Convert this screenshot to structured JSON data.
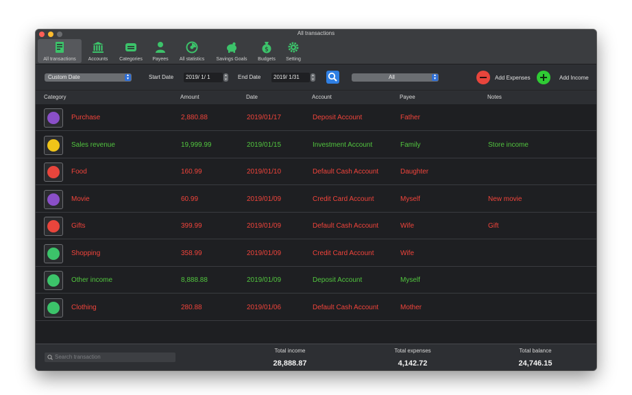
{
  "window": {
    "title": "All transactions"
  },
  "toolbar": {
    "items": [
      {
        "label": "All transactions",
        "icon": "transactions-icon"
      },
      {
        "label": "Accounts",
        "icon": "bank-icon"
      },
      {
        "label": "Categories",
        "icon": "categories-icon"
      },
      {
        "label": "Payees",
        "icon": "person-icon"
      },
      {
        "label": "All statistics",
        "icon": "statistics-icon"
      },
      {
        "label": "Savings Goals",
        "icon": "piggy-bank-icon"
      },
      {
        "label": "Budgets",
        "icon": "money-bag-icon"
      },
      {
        "label": "Setting",
        "icon": "gear-icon"
      }
    ],
    "accent": "#3cc36a"
  },
  "filter": {
    "date_mode": "Custom Date",
    "start_label": "Start Date",
    "start_value": "2019/  1/  1",
    "end_label": "End Date",
    "end_value": "2019/  1/31",
    "account_select": "All",
    "add_expenses": "Add Expenses",
    "add_income": "Add Income"
  },
  "columns": {
    "category": "Category",
    "amount": "Amount",
    "date": "Date",
    "account": "Account",
    "payee": "Payee",
    "notes": "Notes"
  },
  "rows": [
    {
      "category": "Purchase",
      "amount": "2,880.88",
      "date": "2019/01/17",
      "account": "Deposit Account",
      "payee": "Father",
      "notes": "",
      "type": "expense",
      "icon_color": "#8a4fc8"
    },
    {
      "category": "Sales revenue",
      "amount": "19,999.99",
      "date": "2019/01/15",
      "account": "Investment Account",
      "payee": "Family",
      "notes": "Store income",
      "type": "income",
      "icon_color": "#f0c419"
    },
    {
      "category": "Food",
      "amount": "160.99",
      "date": "2019/01/10",
      "account": "Default Cash Account",
      "payee": "Daughter",
      "notes": "",
      "type": "expense",
      "icon_color": "#e8453c"
    },
    {
      "category": "Movie",
      "amount": "60.99",
      "date": "2019/01/09",
      "account": "Credit Card Account",
      "payee": "Myself",
      "notes": "New movie",
      "type": "expense",
      "icon_color": "#8a4fc8"
    },
    {
      "category": "Gifts",
      "amount": "399.99",
      "date": "2019/01/09",
      "account": "Default Cash Account",
      "payee": "Wife",
      "notes": "Gift",
      "type": "expense",
      "icon_color": "#e8453c"
    },
    {
      "category": "Shopping",
      "amount": "358.99",
      "date": "2019/01/09",
      "account": "Credit Card Account",
      "payee": "Wife",
      "notes": "",
      "type": "expense",
      "icon_color": "#3cc36a"
    },
    {
      "category": "Other income",
      "amount": "8,888.88",
      "date": "2019/01/09",
      "account": "Deposit Account",
      "payee": "Myself",
      "notes": "",
      "type": "income",
      "icon_color": "#3cc36a"
    },
    {
      "category": "Clothing",
      "amount": "280.88",
      "date": "2019/01/06",
      "account": "Default Cash Account",
      "payee": "Mother",
      "notes": "",
      "type": "expense",
      "icon_color": "#3cc36a"
    }
  ],
  "colors": {
    "expense": "#f2443b",
    "income": "#52c63f"
  },
  "footer": {
    "search_placeholder": "Search transaction",
    "total_income_label": "Total income",
    "total_income": "28,888.87",
    "total_expenses_label": "Total expenses",
    "total_expenses": "4,142.72",
    "total_balance_label": "Total balance",
    "total_balance": "24,746.15"
  }
}
